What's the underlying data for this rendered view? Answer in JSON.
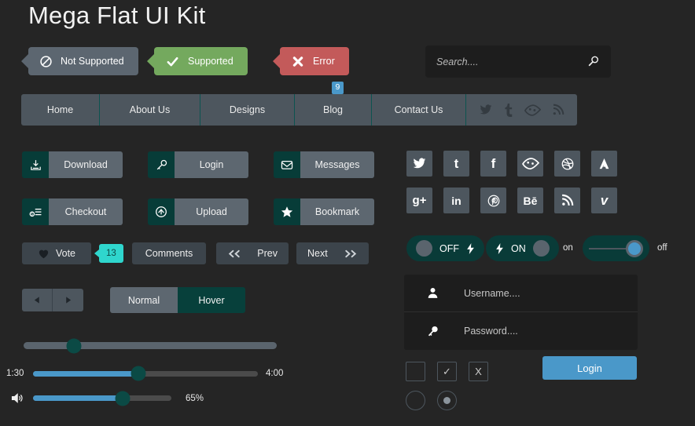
{
  "page": {
    "title": "Mega Flat UI Kit",
    "background": "#252525"
  },
  "badges": [
    {
      "label": "Not Supported",
      "icon": "no-entry-icon",
      "color": "#5c6670"
    },
    {
      "label": "Supported",
      "icon": "check-icon",
      "color": "#74a95e"
    },
    {
      "label": "Error",
      "icon": "x-cross-icon",
      "color": "#c35a5a"
    }
  ],
  "search": {
    "placeholder": "Search....",
    "value": "",
    "icon": "search-icon"
  },
  "nav": {
    "items": [
      {
        "label": "Home",
        "width": 100
      },
      {
        "label": "About Us",
        "width": 128
      },
      {
        "label": "Designs",
        "width": 120
      },
      {
        "label": "Blog",
        "width": 98,
        "badge": "9"
      },
      {
        "label": "Contact Us",
        "width": 120
      }
    ],
    "social": [
      "twitter-icon",
      "tumblr-icon",
      "forrst-icon",
      "rss-icon"
    ]
  },
  "icon_buttons": [
    {
      "label": "Download",
      "icon": "download-icon"
    },
    {
      "label": "Login",
      "icon": "key-icon"
    },
    {
      "label": "Messages",
      "icon": "envelope-icon"
    },
    {
      "label": "Checkout",
      "icon": "cart-icon"
    },
    {
      "label": "Upload",
      "icon": "upload-icon"
    },
    {
      "label": "Bookmark",
      "icon": "star-icon"
    }
  ],
  "action_row": {
    "vote": {
      "label": "Vote",
      "icon": "heart-icon",
      "count": "13",
      "badge_color": "#2fd6cd"
    },
    "comments": {
      "label": "Comments"
    },
    "prev": {
      "label": "Prev",
      "icon": "double-chevron-left-icon"
    },
    "next": {
      "label": "Next",
      "icon": "double-chevron-right-icon"
    }
  },
  "state_tabs": {
    "normal": "Normal",
    "hover": "Hover",
    "hover_color": "#07403b"
  },
  "sliders": {
    "progress": {
      "value_pct": 20
    },
    "time": {
      "start": "1:30",
      "end": "4:00",
      "value_pct": 47,
      "fill_color": "#4a98c9"
    },
    "volume": {
      "label": "65%",
      "value_pct": 65,
      "icon": "volume-icon",
      "fill_color": "#4a98c9"
    }
  },
  "social_grid": {
    "row1": [
      "twitter-icon",
      "tumblr-icon",
      "facebook-icon",
      "forrst-icon",
      "dribbble-icon",
      "adobe-icon"
    ],
    "row2": [
      "google-plus-icon",
      "linkedin-icon",
      "pinterest-icon",
      "behance-icon",
      "rss-icon",
      "vimeo-icon"
    ],
    "row1_labels": [
      "",
      "t",
      "f",
      "",
      "",
      "A"
    ],
    "row2_labels": [
      "g+",
      "in",
      "",
      "Bē",
      "",
      "v"
    ]
  },
  "toggles": {
    "off": {
      "label": "OFF",
      "icon": "bolt-icon"
    },
    "on": {
      "label": "ON",
      "icon": "bolt-icon"
    },
    "slide": {
      "on_label": "on",
      "off_label": "off",
      "state": "off",
      "knob_color": "#4a98c9"
    }
  },
  "login_form": {
    "username": {
      "placeholder": "Username....",
      "value": "",
      "icon": "user-icon"
    },
    "password": {
      "placeholder": "Password....",
      "value": "",
      "icon": "key-icon"
    },
    "submit": {
      "label": "Login",
      "color": "#4a98c9"
    }
  },
  "controls": {
    "checkbox_empty": "",
    "checkbox_checked": "✓",
    "checkbox_x": "X",
    "radio_empty": "",
    "radio_selected": "selected"
  }
}
